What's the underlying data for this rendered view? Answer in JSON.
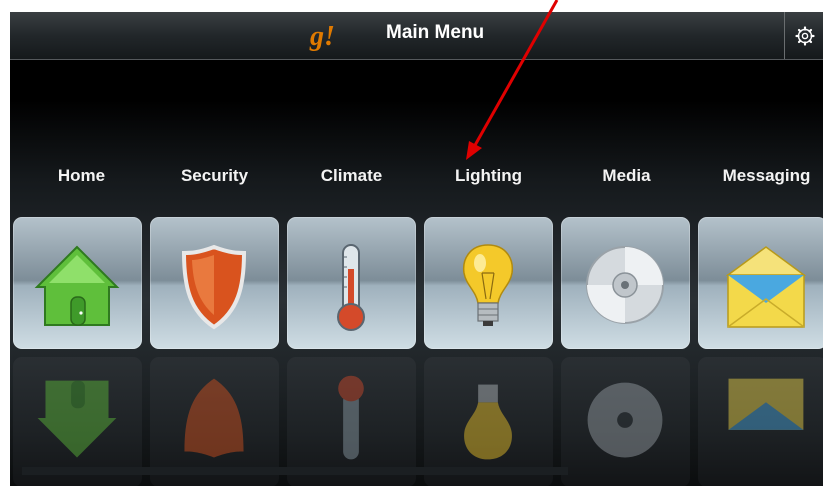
{
  "titlebar": {
    "logo_text": "g!",
    "title": "Main Menu",
    "settings_icon": "gear-icon",
    "accent_color": "#e07a00"
  },
  "menu": {
    "items": [
      {
        "label": "Home",
        "icon": "house-icon",
        "color": "#5fbf3b"
      },
      {
        "label": "Security",
        "icon": "shield-icon",
        "color": "#d9531e"
      },
      {
        "label": "Climate",
        "icon": "thermometer-icon",
        "color": "#d44a2a"
      },
      {
        "label": "Lighting",
        "icon": "lightbulb-icon",
        "color": "#f4c92a"
      },
      {
        "label": "Media",
        "icon": "cd-icon",
        "color": "#c9ced2"
      },
      {
        "label": "Messaging",
        "icon": "envelope-icon",
        "color": "#f3d94a"
      }
    ]
  },
  "annotation": {
    "arrow_color": "#e00000",
    "target": "Lighting"
  }
}
